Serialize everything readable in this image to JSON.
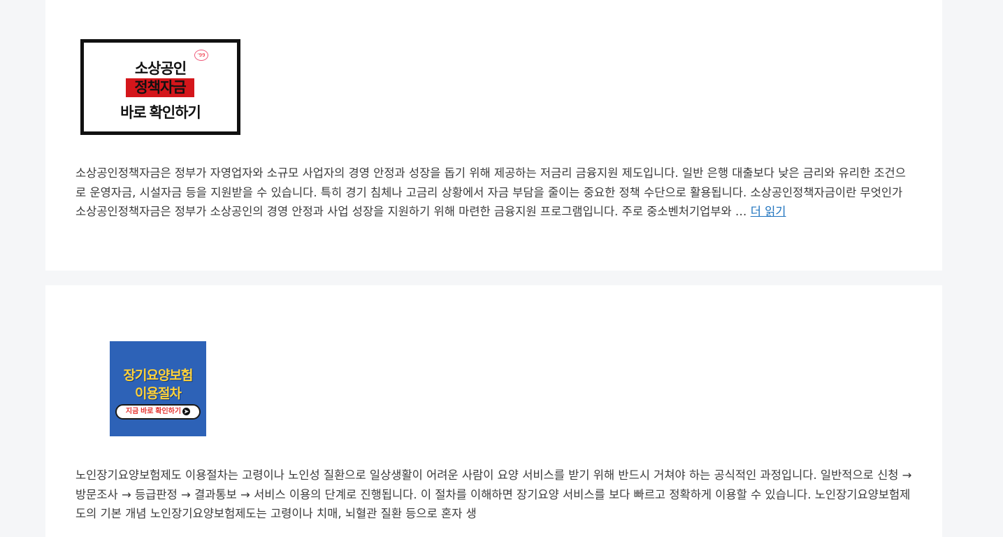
{
  "posts": [
    {
      "thumbnail": {
        "line1": "소상공인",
        "line2": "정책자금",
        "line3": "바로 확인하기",
        "badge": "‘99",
        "colors": {
          "border": "#111111",
          "highlight": "#d4161b"
        }
      },
      "excerpt": "소상공인정책자금은 정부가 자영업자와 소규모 사업자의 경영 안정과 성장을 돕기 위해 제공하는 저금리 금융지원 제도입니다. 일반 은행 대출보다 낮은 금리와 유리한 조건으로 운영자금, 시설자금 등을 지원받을 수 있습니다. 특히 경기 침체나 고금리 상황에서 자금 부담을 줄이는 중요한 정책 수단으로 활용됩니다. 소상공인정책자금이란 무엇인가 소상공인정책자금은 정부가 소상공인의 경영 안정과 사업 성장을 지원하기 위해 마련한 금융지원 프로그램입니다. 주로 중소벤처기업부와 …",
      "read_more": "더 읽기"
    },
    {
      "thumbnail": {
        "line1": "장기요양보험",
        "line2": "이용절차",
        "cta": "지금 바로 확인하기",
        "cta_icon": "arrow-right-icon",
        "colors": {
          "background": "#2d62b7",
          "title": "#ffd23a",
          "cta_text": "#e5322d"
        }
      },
      "excerpt": "노인장기요양보험제도 이용절차는 고령이나 노인성 질환으로 일상생활이 어려운 사람이 요양 서비스를 받기 위해 반드시 거쳐야 하는 공식적인 과정입니다. 일반적으로 신청 → 방문조사 → 등급판정 → 결과통보 → 서비스 이용의 단계로 진행됩니다. 이 절차를 이해하면 장기요양 서비스를 보다 빠르고 정확하게 이용할 수 있습니다. 노인장기요양보험제도의 기본 개념 노인장기요양보험제도는 고령이나 치매, 뇌혈관 질환 등으로 혼자 생"
    }
  ],
  "colors": {
    "page_background": "#f5f6f8",
    "card": "#ffffff",
    "link": "#1e73be",
    "text": "#3a3a3a"
  }
}
